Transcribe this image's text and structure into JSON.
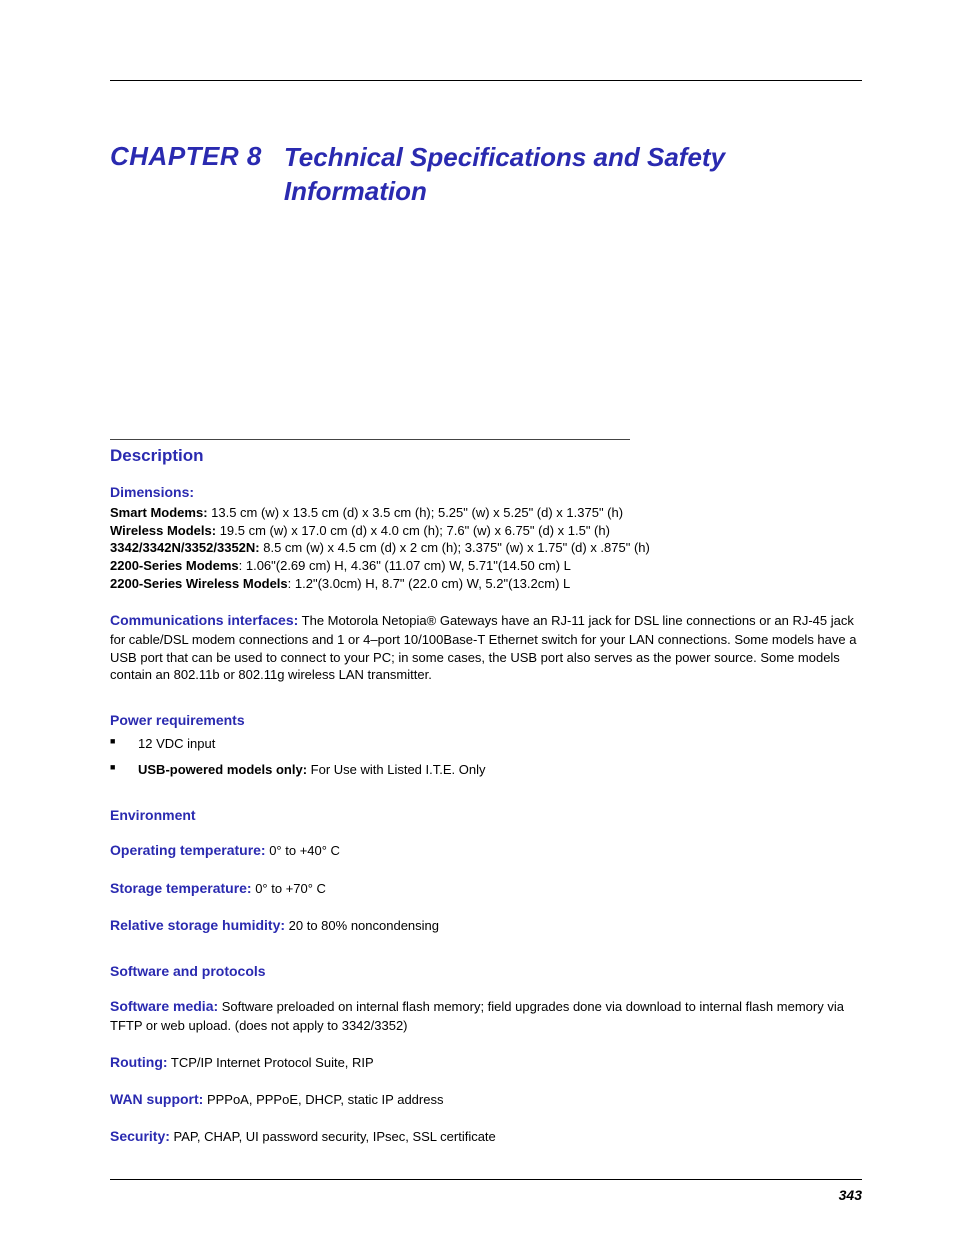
{
  "chapter": {
    "label": "CHAPTER 8",
    "title": "Technical Specifications and Safety Information"
  },
  "section_heading": "Description",
  "dimensions": {
    "heading": "Dimensions:",
    "lines": [
      {
        "label": "Smart Modems:",
        "val": " 13.5 cm (w) x 13.5 cm (d) x 3.5 cm (h); 5.25\" (w) x 5.25\" (d) x 1.375\" (h)"
      },
      {
        "label": "Wireless Models:",
        "val": " 19.5 cm (w) x 17.0 cm (d) x 4.0 cm (h); 7.6\" (w) x 6.75\" (d) x 1.5\" (h)"
      },
      {
        "label": "3342/3342N/3352/3352N:",
        "val": " 8.5 cm (w) x 4.5 cm (d) x 2 cm (h); 3.375\" (w) x 1.75\" (d) x .875\" (h)"
      },
      {
        "label": "2200-Series Modems",
        "val": ": 1.06\"(2.69 cm) H, 4.36\" (11.07 cm) W, 5.71\"(14.50 cm) L"
      },
      {
        "label": "2200-Series Wireless Models",
        "val": ": 1.2\"(3.0cm) H, 8.7\" (22.0 cm) W, 5.2\"(13.2cm) L"
      }
    ]
  },
  "comm": {
    "label": "Communications interfaces:",
    "text": " The Motorola Netopia® Gateways have an RJ-11 jack for DSL line connections or an RJ-45 jack for cable/DSL modem connections and 1 or 4–port 10/100Base-T Ethernet switch for your LAN connections. Some models have a USB port that can be used to connect to your PC; in some cases, the USB port also serves as the power source. Some models contain an 802.11b or 802.11g wireless LAN transmitter."
  },
  "power": {
    "heading": "Power requirements",
    "items": [
      {
        "bold": "",
        "text": "12 VDC input"
      },
      {
        "bold": "USB-powered models only:",
        "text": " For Use with Listed I.T.E. Only"
      }
    ]
  },
  "env": {
    "heading": "Environment",
    "rows": [
      {
        "k": "Operating temperature:",
        "v": " 0° to +40° C"
      },
      {
        "k": "Storage temperature:",
        "v": " 0° to +70° C"
      },
      {
        "k": "Relative storage humidity:",
        "v": " 20 to 80% noncondensing"
      }
    ]
  },
  "soft": {
    "heading": "Software and protocols",
    "rows": [
      {
        "k": "Software media:",
        "v": " Software preloaded on internal flash memory; field upgrades done via download to internal flash memory via TFTP or web upload. (does not apply to 3342/3352)"
      },
      {
        "k": "Routing:",
        "v": " TCP/IP Internet Protocol Suite, RIP"
      },
      {
        "k": "WAN support:",
        "v": " PPPoA, PPPoE, DHCP, static IP address"
      },
      {
        "k": "Security:",
        "v": " PAP, CHAP, UI password security, IPsec, SSL certificate"
      }
    ]
  },
  "page_number": "343"
}
